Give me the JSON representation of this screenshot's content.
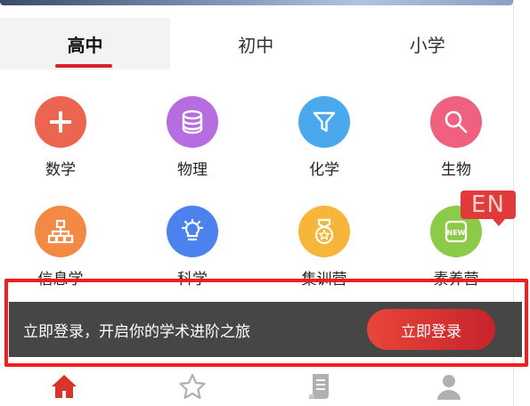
{
  "tabs": [
    {
      "label": "高中",
      "active": true
    },
    {
      "label": "初中",
      "active": false
    },
    {
      "label": "小学",
      "active": false
    }
  ],
  "subjects": [
    {
      "label": "数学",
      "icon": "plus-icon",
      "color": "#ec6550"
    },
    {
      "label": "物理",
      "icon": "database-icon",
      "color": "#b66de0"
    },
    {
      "label": "化学",
      "icon": "filter-icon",
      "color": "#4aa8ec"
    },
    {
      "label": "生物",
      "icon": "search-icon",
      "color": "#f0607f"
    },
    {
      "label": "信息学",
      "icon": "sitemap-icon",
      "color": "#f28a45"
    },
    {
      "label": "科学",
      "icon": "lightbulb-icon",
      "color": "#4c82ee"
    },
    {
      "label": "集训营",
      "icon": "medal-icon",
      "color": "#f5b63a"
    },
    {
      "label": "素养营",
      "icon": "new-badge-icon",
      "color": "#8ccb4a"
    }
  ],
  "en_badge": "EN",
  "login_bar": {
    "text": "立即登录，开启你的学术进阶之旅",
    "button": "立即登录"
  },
  "bottom_nav": [
    {
      "icon": "home-icon",
      "active": true
    },
    {
      "icon": "star-icon",
      "active": false
    },
    {
      "icon": "document-icon",
      "active": false
    },
    {
      "icon": "user-icon",
      "active": false
    }
  ],
  "colors": {
    "accent": "#d8232a",
    "highlight": "#f41d1d",
    "nav_active": "#d8342c",
    "nav_inactive": "#b0b0b0"
  }
}
